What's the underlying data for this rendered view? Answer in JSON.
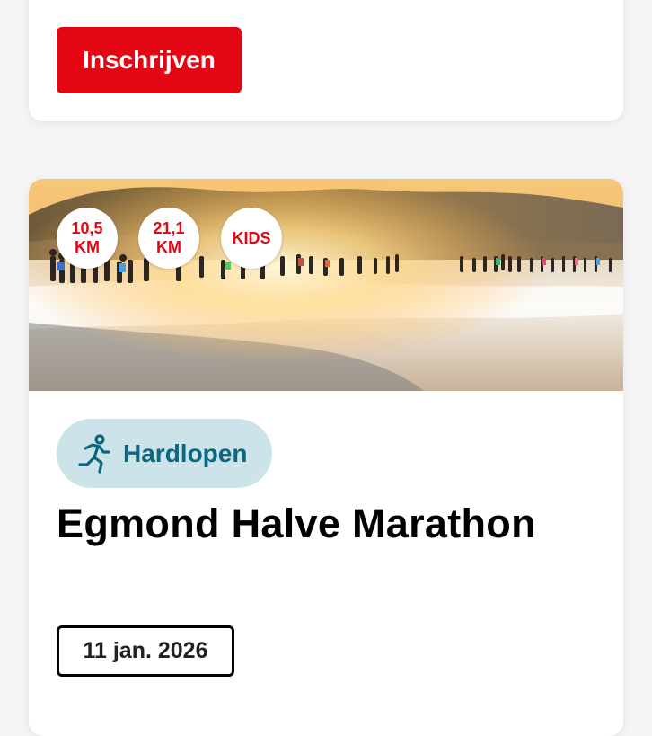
{
  "signup": {
    "label": "Inschrijven"
  },
  "event": {
    "distances": [
      {
        "line1": "10,5",
        "line2": "KM"
      },
      {
        "line1": "21,1",
        "line2": "KM"
      },
      {
        "line1": "KIDS",
        "line2": ""
      }
    ],
    "sport": {
      "label": "Hardlopen",
      "icon": "runner-icon"
    },
    "title": "Egmond Halve Marathon",
    "date": "11 jan. 2026"
  },
  "colors": {
    "brand_red": "#e30613",
    "sport_pill_bg": "#cde3ea",
    "sport_text": "#0e6780"
  }
}
